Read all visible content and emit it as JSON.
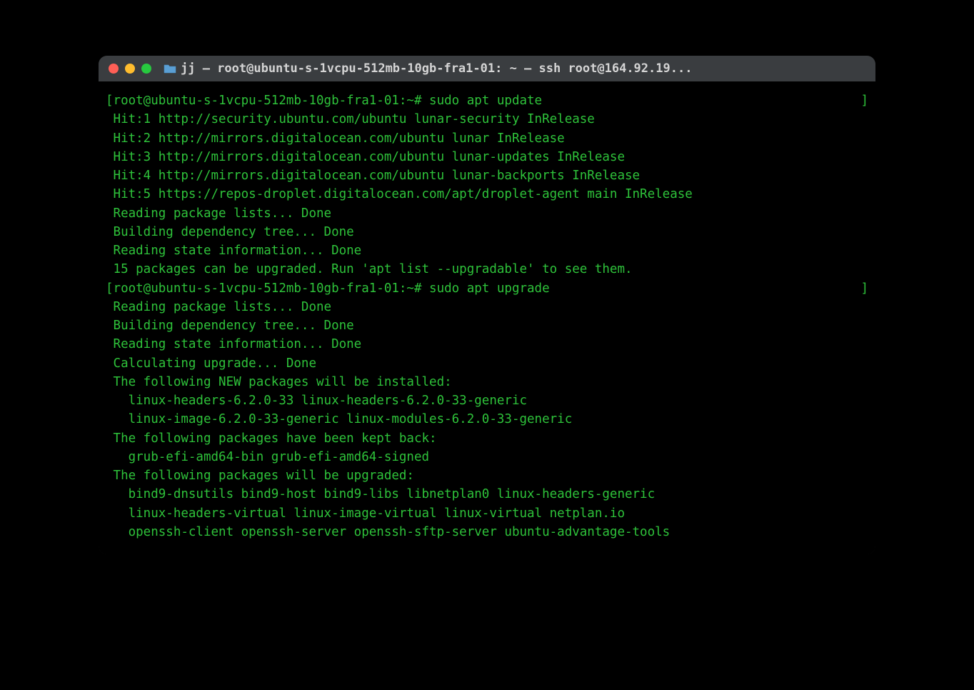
{
  "window": {
    "title": "jj — root@ubuntu-s-1vcpu-512mb-10gb-fra1-01: ~ — ssh root@164.92.19..."
  },
  "terminal": {
    "lines": [
      {
        "text": "[root@ubuntu-s-1vcpu-512mb-10gb-fra1-01:~# sudo apt update",
        "bracket": true
      },
      {
        "text": " Hit:1 http://security.ubuntu.com/ubuntu lunar-security InRelease"
      },
      {
        "text": " Hit:2 http://mirrors.digitalocean.com/ubuntu lunar InRelease"
      },
      {
        "text": " Hit:3 http://mirrors.digitalocean.com/ubuntu lunar-updates InRelease"
      },
      {
        "text": " Hit:4 http://mirrors.digitalocean.com/ubuntu lunar-backports InRelease"
      },
      {
        "text": " Hit:5 https://repos-droplet.digitalocean.com/apt/droplet-agent main InRelease"
      },
      {
        "text": " Reading package lists... Done"
      },
      {
        "text": " Building dependency tree... Done"
      },
      {
        "text": " Reading state information... Done"
      },
      {
        "text": " 15 packages can be upgraded. Run 'apt list --upgradable' to see them."
      },
      {
        "text": "[root@ubuntu-s-1vcpu-512mb-10gb-fra1-01:~# sudo apt upgrade",
        "bracket": true
      },
      {
        "text": " Reading package lists... Done"
      },
      {
        "text": " Building dependency tree... Done"
      },
      {
        "text": " Reading state information... Done"
      },
      {
        "text": " Calculating upgrade... Done"
      },
      {
        "text": " The following NEW packages will be installed:"
      },
      {
        "text": "   linux-headers-6.2.0-33 linux-headers-6.2.0-33-generic"
      },
      {
        "text": "   linux-image-6.2.0-33-generic linux-modules-6.2.0-33-generic"
      },
      {
        "text": " The following packages have been kept back:"
      },
      {
        "text": "   grub-efi-amd64-bin grub-efi-amd64-signed"
      },
      {
        "text": " The following packages will be upgraded:"
      },
      {
        "text": "   bind9-dnsutils bind9-host bind9-libs libnetplan0 linux-headers-generic"
      },
      {
        "text": "   linux-headers-virtual linux-image-virtual linux-virtual netplan.io"
      },
      {
        "text": "   openssh-client openssh-server openssh-sftp-server ubuntu-advantage-tools"
      }
    ]
  }
}
